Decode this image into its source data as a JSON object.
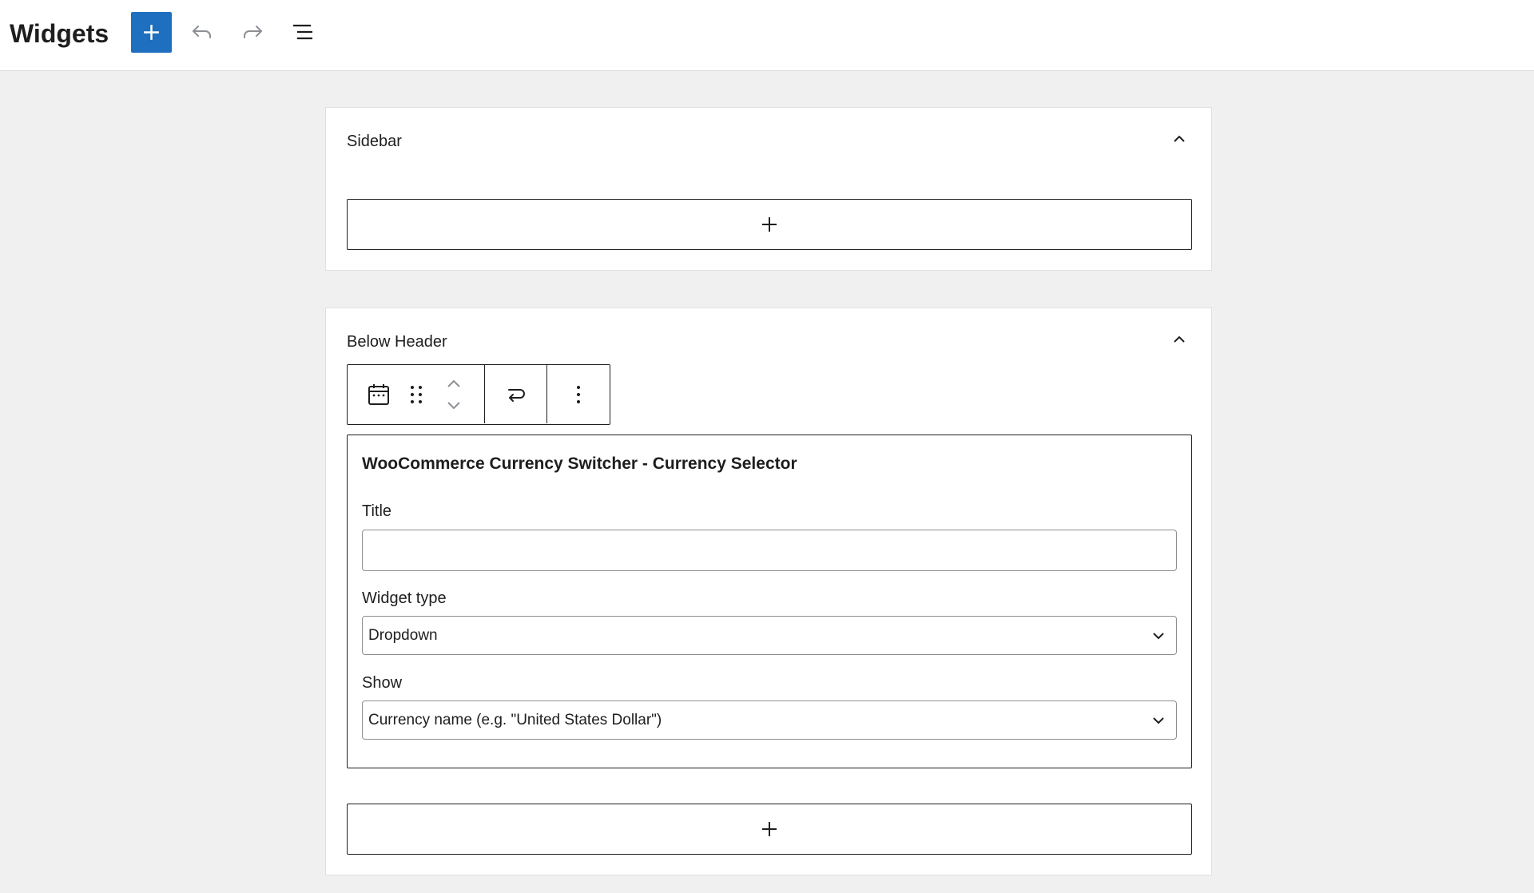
{
  "header": {
    "title": "Widgets",
    "icons": {
      "add": "plus-icon",
      "undo": "undo-icon",
      "redo": "redo-icon",
      "outline": "list-view-icon"
    },
    "accent_color": "#1e6fbf"
  },
  "areas": [
    {
      "title": "Sidebar",
      "collapse_icon": "chevron-up-icon",
      "appender_icon": "plus-icon"
    },
    {
      "title": "Below Header",
      "collapse_icon": "chevron-up-icon",
      "appender_icon": "plus-icon",
      "block_toolbar": {
        "icons": [
          "calendar-icon",
          "drag-handle-icon",
          "move-up-icon",
          "move-down-icon",
          "transform-icon",
          "more-options-icon"
        ]
      },
      "widget": {
        "heading": "WooCommerce Currency Switcher - Currency Selector",
        "fields": {
          "title": {
            "label": "Title",
            "value": ""
          },
          "widget_type": {
            "label": "Widget type",
            "value": "Dropdown"
          },
          "show": {
            "label": "Show",
            "value": "Currency name (e.g. \"United States Dollar\")"
          }
        }
      }
    }
  ]
}
